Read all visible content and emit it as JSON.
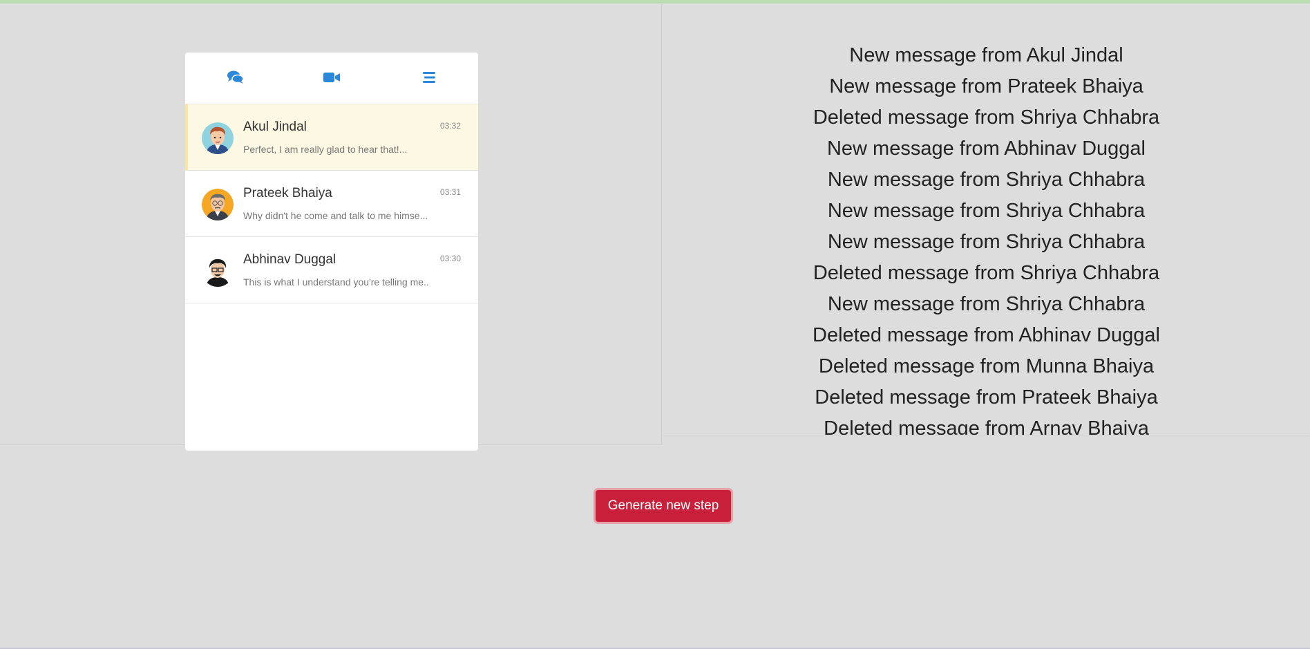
{
  "tabs": [
    {
      "icon": "chat-bubbles-icon"
    },
    {
      "icon": "video-camera-icon"
    },
    {
      "icon": "menu-lines-icon"
    }
  ],
  "conversations": [
    {
      "name": "Akul Jindal",
      "time": "03:32",
      "preview": "Perfect, I am really glad to hear that!...",
      "active": true
    },
    {
      "name": "Prateek Bhaiya",
      "time": "03:31",
      "preview": "Why didn't he come and talk to me himse...",
      "active": false
    },
    {
      "name": "Abhinav Duggal",
      "time": "03:30",
      "preview": "This is what I understand you're telling me..",
      "active": false
    }
  ],
  "log": [
    "New message from Akul Jindal",
    "New message from Prateek Bhaiya",
    "Deleted message from Shriya Chhabra",
    "New message from Abhinav Duggal",
    "New message from Shriya Chhabra",
    "New message from Shriya Chhabra",
    "New message from Shriya Chhabra",
    "Deleted message from Shriya Chhabra",
    "New message from Shriya Chhabra",
    "Deleted message from Abhinav Duggal",
    "Deleted message from Munna Bhaiya",
    "Deleted message from Prateek Bhaiya",
    "Deleted message from Arnav Bhaiya"
  ],
  "button": {
    "label": "Generate new step"
  },
  "colors": {
    "accent": "#2b87da",
    "button": "#c8203a",
    "active_row": "#fdf8e3"
  }
}
